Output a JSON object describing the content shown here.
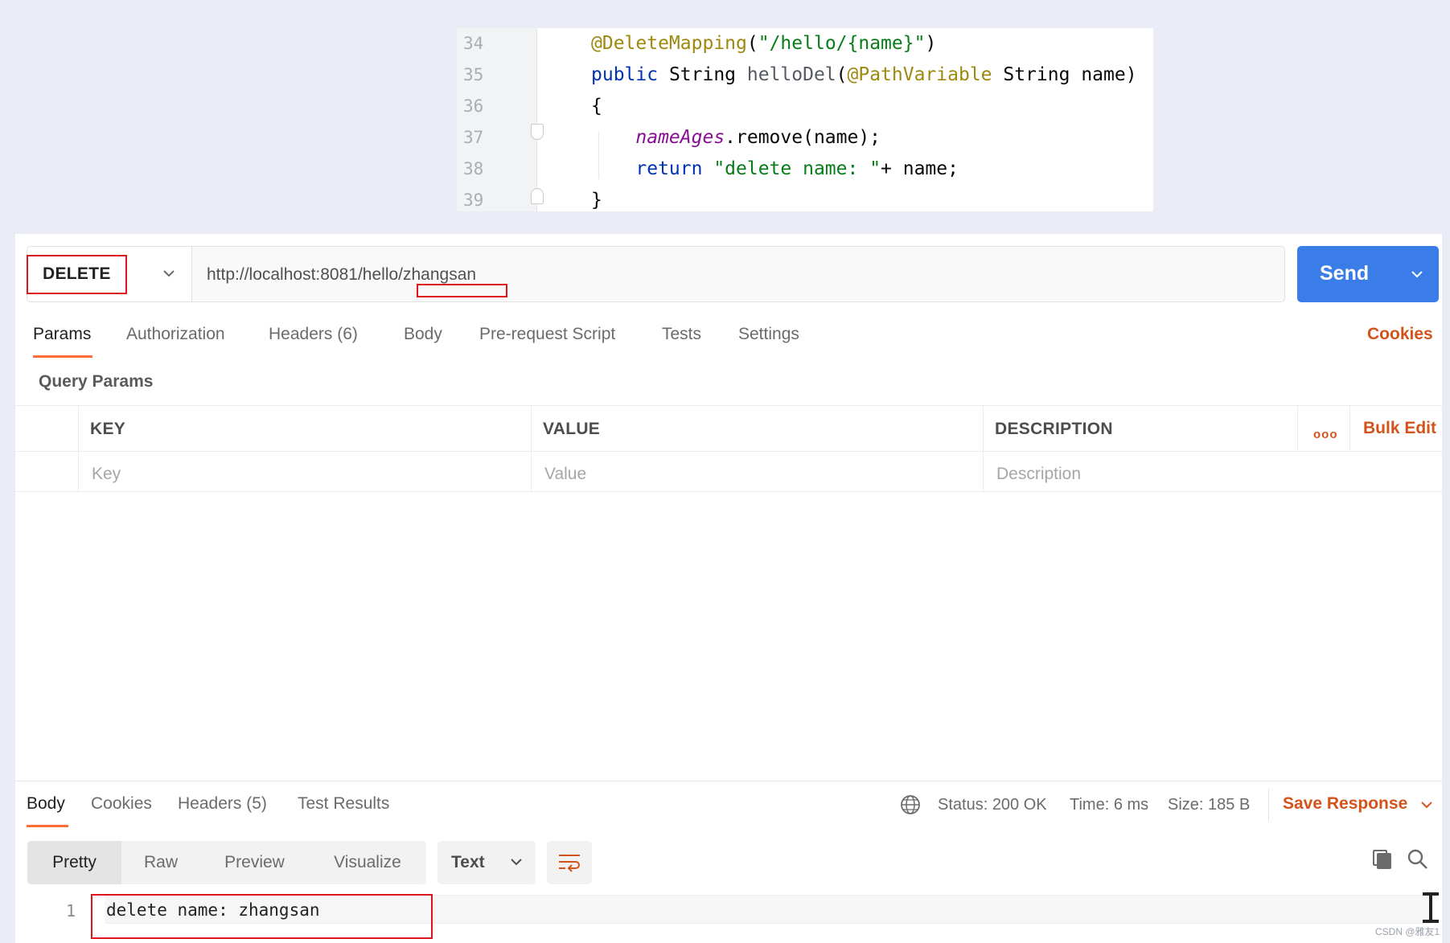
{
  "code": {
    "lines": [
      {
        "num": "34",
        "parts": [
          {
            "t": "@DeleteMapping",
            "c": "c-ann"
          },
          {
            "t": "(",
            "c": "c-def"
          },
          {
            "t": "\"/hello/{name}\"",
            "c": "c-str"
          },
          {
            "t": ")",
            "c": "c-def"
          }
        ]
      },
      {
        "num": "35",
        "parts": [
          {
            "t": "public ",
            "c": "c-kw"
          },
          {
            "t": "String ",
            "c": "c-def"
          },
          {
            "t": "helloDel",
            "c": "c-gray"
          },
          {
            "t": "(",
            "c": "c-def"
          },
          {
            "t": "@PathVariable ",
            "c": "c-ann"
          },
          {
            "t": "String name)",
            "c": "c-def"
          }
        ]
      },
      {
        "num": "36",
        "parts": [
          {
            "t": "{",
            "c": "c-def"
          }
        ]
      },
      {
        "num": "37",
        "parts": [
          {
            "t": "    ",
            "c": "c-def"
          },
          {
            "t": "nameAges",
            "c": "c-field"
          },
          {
            "t": ".remove(name);",
            "c": "c-def"
          }
        ]
      },
      {
        "num": "38",
        "parts": [
          {
            "t": "    ",
            "c": "c-def"
          },
          {
            "t": "return ",
            "c": "c-kw"
          },
          {
            "t": "\"delete name: \"",
            "c": "c-str"
          },
          {
            "t": "+ name;",
            "c": "c-def"
          }
        ]
      },
      {
        "num": "39",
        "parts": [
          {
            "t": "}",
            "c": "c-def"
          }
        ]
      }
    ]
  },
  "request": {
    "method": "DELETE",
    "url": "http://localhost:8081/hello/zhangsan",
    "send_label": "Send"
  },
  "request_tabs": [
    "Params",
    "Authorization",
    "Headers (6)",
    "Body",
    "Pre-request Script",
    "Tests",
    "Settings"
  ],
  "cookies_link": "Cookies",
  "query_params": {
    "title": "Query Params",
    "headers": [
      "KEY",
      "VALUE",
      "DESCRIPTION"
    ],
    "placeholders": [
      "Key",
      "Value",
      "Description"
    ],
    "more": "ooo",
    "bulk_edit": "Bulk Edit"
  },
  "response": {
    "tabs": [
      "Body",
      "Cookies",
      "Headers (5)",
      "Test Results"
    ],
    "status": "Status: 200 OK",
    "time": "Time: 6 ms",
    "size": "Size: 185 B",
    "save_response": "Save Response",
    "view_modes": [
      "Pretty",
      "Raw",
      "Preview",
      "Visualize"
    ],
    "format": "Text",
    "line_number": "1",
    "body_text": "delete name: zhangsan"
  },
  "watermark": "CSDN @雅友1",
  "colors": {
    "accent_orange": "#ff6c37",
    "link_orange": "#d3541b",
    "send_blue": "#3a7de8",
    "highlight_red": "#e0151b"
  }
}
